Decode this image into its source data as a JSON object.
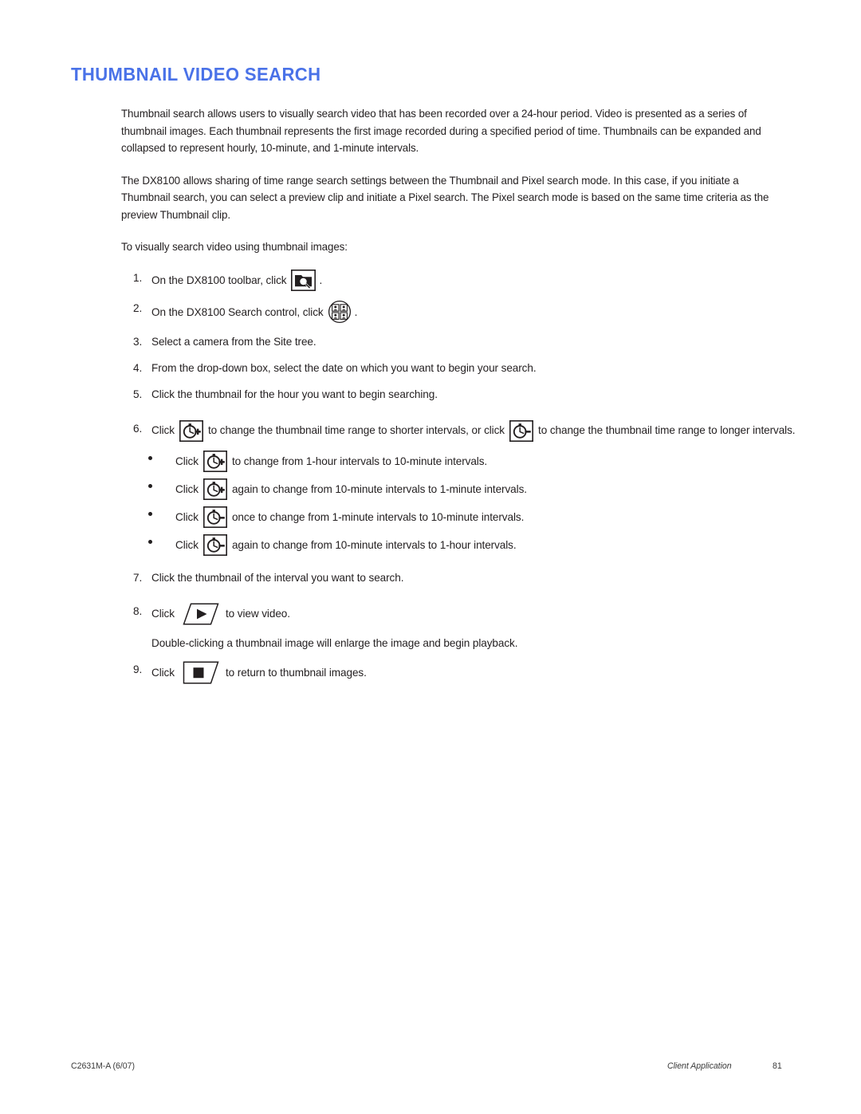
{
  "document": {
    "heading": "THUMBNAIL VIDEO SEARCH",
    "heading_color": "#4a72e8",
    "paragraphs": [
      "Thumbnail search allows users to visually search video that has been recorded over a 24-hour period. Video is presented as a series of thumbnail images. Each thumbnail represents the first image recorded during a specified period of time. Thumbnails can be expanded and collapsed to represent hourly, 10-minute, and 1-minute intervals.",
      "The DX8100 allows sharing of time range search settings between the Thumbnail and Pixel search mode. In this case, if you initiate a Thumbnail search, you can select a preview clip and initiate a Pixel search. The Pixel search mode is based on the same time criteria as the preview Thumbnail clip.",
      "To visually search video using thumbnail images:"
    ],
    "steps": [
      {
        "number": "1.",
        "text_before": "On the DX8100 toolbar, click",
        "icon": "folder-search-icon",
        "text_after": "."
      },
      {
        "number": "2.",
        "text_before": "On the DX8100 Search control, click",
        "icon": "thumbnail-grid-icon",
        "text_after": "."
      },
      {
        "number": "3.",
        "text_before": "Select a camera from the Site tree.",
        "icon": "",
        "text_after": ""
      },
      {
        "number": "4.",
        "text_before": "From the drop-down box, select the date on which you want to begin your search.",
        "icon": "",
        "text_after": ""
      },
      {
        "number": "5.",
        "text_before": "Click the thumbnail for the hour you want to begin searching.",
        "icon": "",
        "text_after": ""
      },
      {
        "number": "6.",
        "text_before": "Click",
        "icon": "clock-plus-icon",
        "text_mid": "to change the thumbnail time range to shorter intervals, or click",
        "icon2": "clock-minus-icon",
        "text_after": "to change the thumbnail time range to longer intervals."
      },
      {
        "number": "7.",
        "text_before": "Click the thumbnail of the interval you want to search.",
        "icon": "",
        "text_after": ""
      },
      {
        "number": "8.",
        "text_before": "Click",
        "icon": "play-button-icon",
        "text_after": "to view video."
      },
      {
        "number": "9.",
        "text_before": "Click",
        "icon": "stop-button-icon",
        "text_after": "to return to thumbnail images."
      }
    ],
    "bullets": [
      {
        "text_before": "Click",
        "icon": "clock-plus-icon",
        "text_after": "to change from 1-hour intervals to 10-minute intervals."
      },
      {
        "text_before": "Click",
        "icon": "clock-plus-icon",
        "text_after": "again to change from 10-minute intervals to 1-minute intervals."
      },
      {
        "text_before": "Click",
        "icon": "clock-minus-icon",
        "text_after": "once to change from 1-minute intervals to 10-minute intervals."
      },
      {
        "text_before": "Click",
        "icon": "clock-minus-icon",
        "text_after": "again to change from 10-minute intervals to 1-hour intervals."
      }
    ],
    "note": "Double-clicking a thumbnail image will enlarge the image and begin playback."
  },
  "footer": {
    "part_number": "C2631M-A (6/07)",
    "section": "Client Application",
    "page_number": "81"
  }
}
